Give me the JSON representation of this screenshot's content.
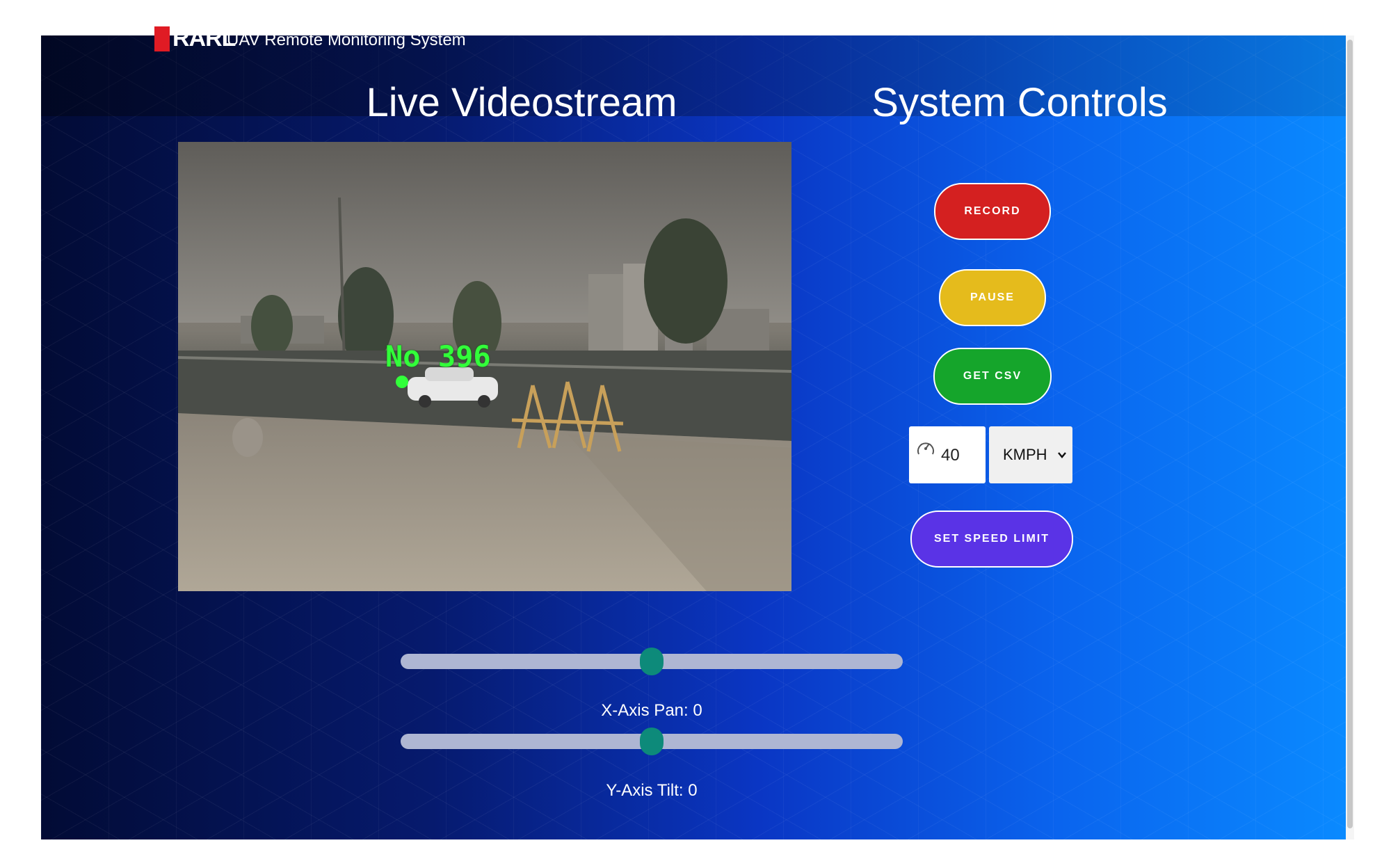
{
  "header": {
    "logo_text": "RARL",
    "app_title": "UAV Remote Monitoring System"
  },
  "video_section": {
    "title": "Live Videostream",
    "detection_label": "No 396"
  },
  "controls": {
    "title": "System Controls",
    "record_label": "RECORD",
    "pause_label": "PAUSE",
    "csv_label": "GET CSV",
    "speed_value": "40",
    "speed_icon": "speedometer-icon",
    "unit_selected": "KMPH",
    "set_speed_label": "SET SPEED LIMIT"
  },
  "sliders": {
    "x_label": "X-Axis Pan: 0",
    "x_value": 0,
    "y_label": "Y-Axis Tilt: 0",
    "y_value": 0
  },
  "colors": {
    "record": "#d42020",
    "pause": "#e5bb1c",
    "csv": "#15a52b",
    "set_speed": "#5a33e6",
    "slider_thumb": "#0d8a7a",
    "detection": "#32ff3a"
  }
}
